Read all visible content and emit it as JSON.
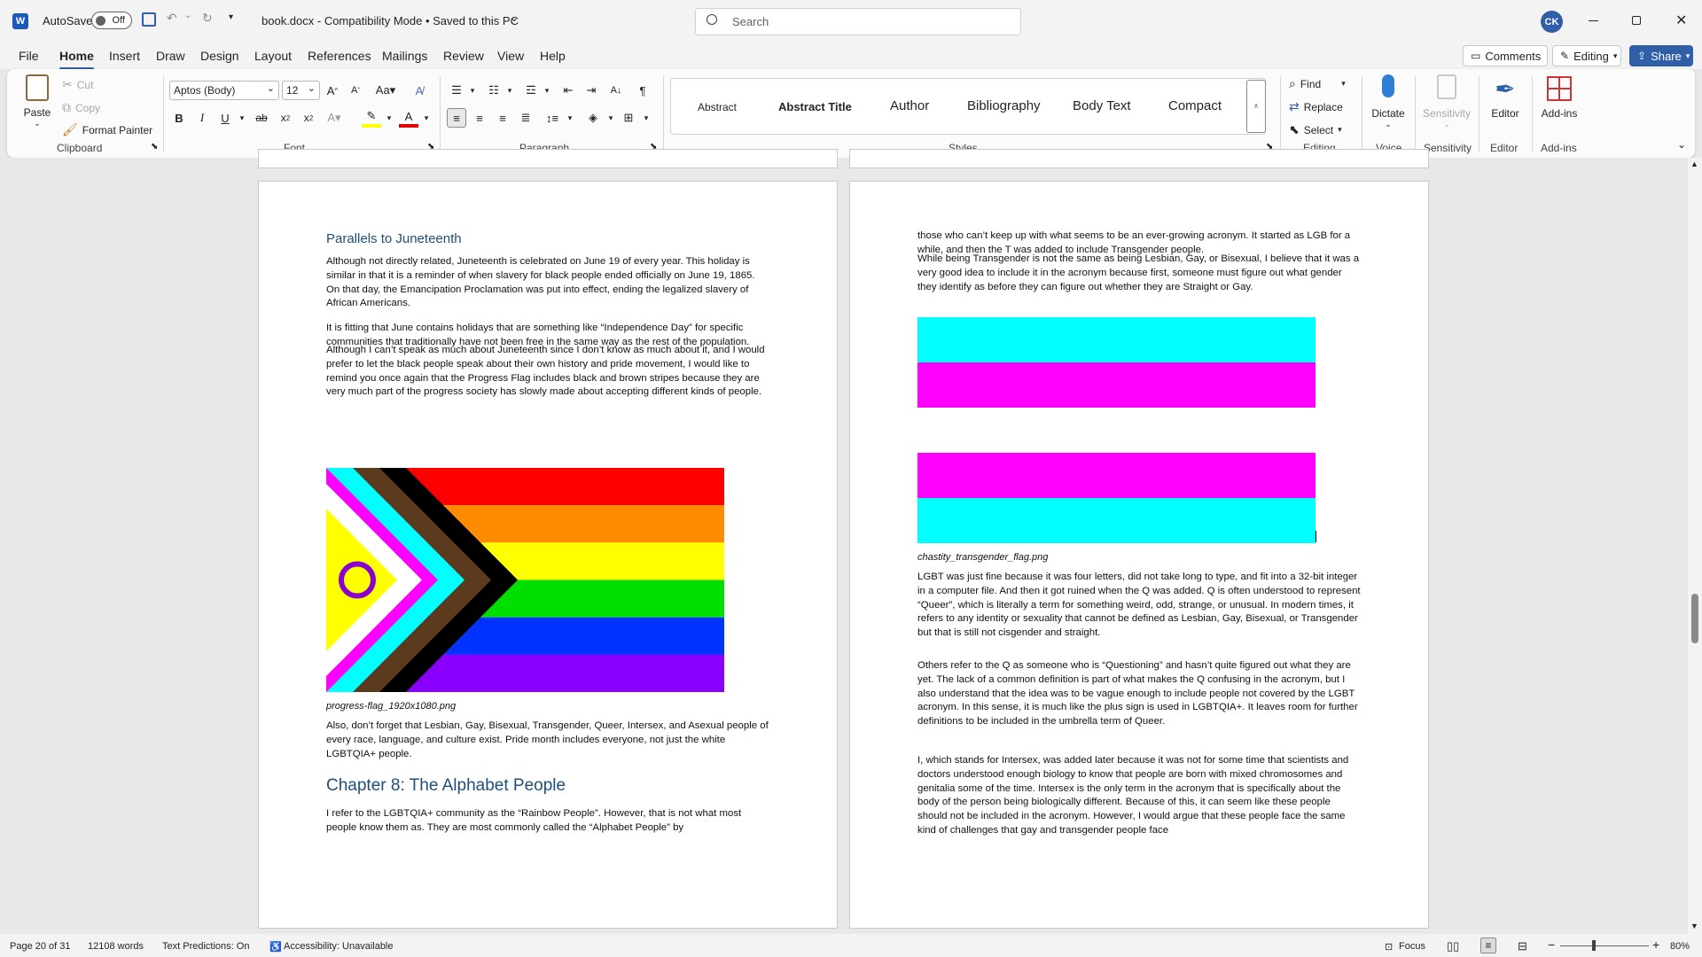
{
  "titlebar": {
    "autosave_label": "AutoSave",
    "autosave_state": "Off",
    "doc_title": "book.docx  -  Compatibility Mode  •  Saved to this PC",
    "search_placeholder": "Search",
    "user_initials": "CK"
  },
  "menubar": {
    "tabs": [
      "File",
      "Home",
      "Insert",
      "Draw",
      "Design",
      "Layout",
      "References",
      "Mailings",
      "Review",
      "View",
      "Help"
    ],
    "comments_label": "Comments",
    "editing_label": "Editing",
    "share_label": "Share"
  },
  "ribbon": {
    "clipboard": {
      "paste": "Paste",
      "cut": "Cut",
      "copy": "Copy",
      "format_painter": "Format Painter",
      "group": "Clipboard"
    },
    "font": {
      "family": "Aptos (Body)",
      "size": "12",
      "group": "Font"
    },
    "paragraph": {
      "group": "Paragraph"
    },
    "styles": {
      "items": [
        "Abstract",
        "Abstract Title",
        "Author",
        "Bibliography",
        "Body Text",
        "Compact"
      ],
      "group": "Styles"
    },
    "editing": {
      "find": "Find",
      "replace": "Replace",
      "select": "Select",
      "group": "Editing"
    },
    "voice": {
      "dictate": "Dictate",
      "group": "Voice"
    },
    "sensitivity": {
      "label": "Sensitivity",
      "group": "Sensitivity"
    },
    "editor": {
      "label": "Editor",
      "group": "Editor"
    },
    "addins": {
      "label": "Add-ins",
      "group": "Add-ins"
    }
  },
  "page_left": {
    "heading": "Parallels to Juneteenth",
    "p1": "Although not directly related, Juneteenth is celebrated on June 19 of every year. This holiday is similar in that it is a reminder of when slavery for black people ended officially on June 19, 1865. On that day, the Emancipation Proclamation was put into effect, ending the legalized slavery of African Americans.",
    "p2": "It is fitting that June contains holidays that are something like “Independence Day” for specific communities that traditionally have not been free in the same way as the rest of the population.",
    "p3": "Although I can’t speak as much about Juneteenth since I don’t know as much about it, and I would prefer to let the black people speak about their own history and pride movement, I would like to remind you once again that the Progress Flag includes black and brown stripes because they are very much part of the progress society has slowly made about accepting different kinds of people.",
    "caption": "progress-flag_1920x1080.png",
    "p4": "Also, don’t forget that Lesbian, Gay, Bisexual, Transgender, Queer, Intersex, and Asexual people of every race, language, and culture exist. Pride month includes everyone, not just the white LGBTQIA+ people.",
    "chapter": "Chapter 8: The Alphabet People",
    "p5": "I refer to the LGBTQIA+ community as the “Rainbow People”. However, that is not what most people know them as. They are most commonly called the “Alphabet People” by"
  },
  "page_right": {
    "p1": "those who can’t keep up with what seems to be an ever-growing acronym. It started as LGB for a while, and then the T was added to include Transgender people.",
    "p2": "While being Transgender is not the same as being Lesbian, Gay, or Bisexual, I believe that it was a very good idea to include it in the acronym because first, someone must figure out what gender they identify as before they can figure out whether they are Straight or Gay.",
    "caption": "chastity_transgender_flag.png",
    "p3": "LGBT was just fine because it was four letters, did not take long to type, and fit into a 32-bit integer in a computer file. And then it got ruined when the Q was added. Q is often understood to represent “Queer”, which is literally a term for something weird, odd, strange, or unusual. In modern times, it refers to any identity or sexuality that cannot be defined as Lesbian, Gay, Bisexual, or Transgender but that is still not cisgender and straight.",
    "p4": "Others refer to the Q as someone who is “Questioning” and hasn’t quite figured out what they are yet. The lack of a common definition is part of what makes the Q confusing in the acronym, but I also understand that the idea was to be vague enough to include people not covered by the LGBT acronym. In this sense, it is much like the plus sign is used in LGBTQIA+. It leaves room for further definitions to be included in the umbrella term of Queer.",
    "p5": "I, which stands for Intersex, was added later because it was not for some time that scientists and doctors understood enough biology to know that people are born with mixed chromosomes and genitalia some of the time. Intersex is the only term in the acronym that is specifically about the body of the person being biologically different. Because of this, it can seem like these people should not be included in the acronym. However, I would argue that these people face the same kind of challenges that gay and transgender people face"
  },
  "statusbar": {
    "page": "Page 20 of 31",
    "words": "12108 words",
    "predictions": "Text Predictions: On",
    "accessibility": "Accessibility: Unavailable",
    "focus": "Focus",
    "zoom": "80%"
  },
  "colors": {
    "accent": "#2f5fa7",
    "heading": "#1f4e79",
    "cyan": "#00ffff",
    "magenta": "#ff00ff"
  }
}
